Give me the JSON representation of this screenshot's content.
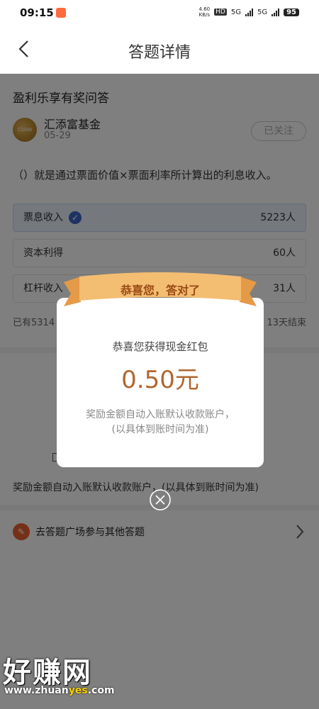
{
  "status": {
    "time": "09:15",
    "speed_value": "4.60",
    "speed_unit": "KB/s",
    "hd": "HD",
    "net1": "5G",
    "net2": "5G",
    "battery": "95"
  },
  "nav": {
    "title": "答题详情"
  },
  "quiz": {
    "section_title": "盈利乐享有奖问答",
    "fund_logo_text": "CUAN",
    "fund_name": "汇添富基金",
    "date": "05-29",
    "follow_label": "已关注",
    "question": "（）就是通过票面价值×票面利率所计算出的利息收入。",
    "options": [
      {
        "label": "票息收入",
        "count": "5223人",
        "selected": true
      },
      {
        "label": "资本利得",
        "count": "60人"
      },
      {
        "label": "杠杆收入",
        "count": "31人"
      }
    ],
    "participants": "已有5314",
    "end_time": "13天结束",
    "bonus_note": "奖励金额自动入账默认收款账户，(以具体到账时间为准)"
  },
  "plaza": {
    "label": "去答题广场参与其他答题"
  },
  "dialog": {
    "ribbon": "恭喜您，答对了",
    "subtitle": "恭喜您获得现金红包",
    "amount": "0.50元",
    "note_line1": "奖励金额自动入账默认收款账户，",
    "note_line2": "(以具体到账时间为准)"
  },
  "watermark": {
    "main": "好赚网",
    "url_prefix": "www.zhuan",
    "url_highlight": "yes",
    "url_suffix": ".com"
  },
  "colors": {
    "accent": "#3a67c8",
    "amount": "#b1662f",
    "ribbon": "#f0b568"
  }
}
